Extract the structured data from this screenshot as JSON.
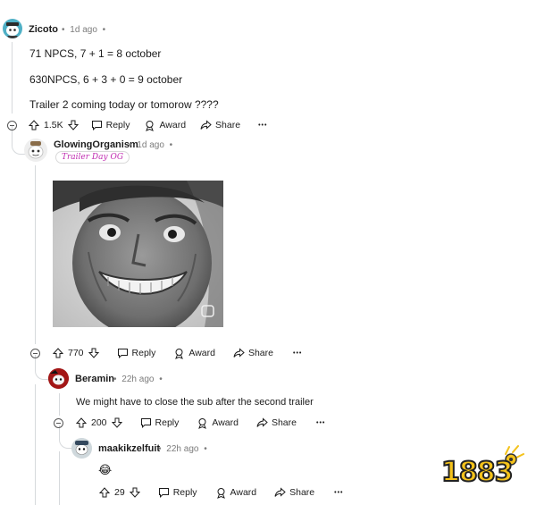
{
  "comments": [
    {
      "username": "Zicoto",
      "age": "1d ago",
      "lines": [
        "71 NPCS, 7 + 1 = 8 october",
        "630NPCS, 6 + 3 + 0 = 9 october",
        "Trailer 2 coming today or tomorow ????"
      ],
      "votes": "1.5K",
      "reply_label": "Reply",
      "award_label": "Award",
      "share_label": "Share",
      "more_label": "•••"
    },
    {
      "username": "GlowingOrganism",
      "age": "1d ago",
      "flair": "Trailer Day OG",
      "image_icon": "gif-reaction-image",
      "votes": "770",
      "reply_label": "Reply",
      "award_label": "Award",
      "share_label": "Share",
      "more_label": "•••"
    },
    {
      "username": "Beramin",
      "age": "22h ago",
      "text": "We might have to close the sub after the second trailer",
      "votes": "200",
      "reply_label": "Reply",
      "award_label": "Award",
      "share_label": "Share",
      "more_label": "•••"
    },
    {
      "username": "maakikzelfuit",
      "age": "22h ago",
      "emoji": "😂",
      "votes": "29",
      "reply_label": "Reply",
      "award_label": "Award",
      "share_label": "Share",
      "more_label": "•••"
    }
  ],
  "separator": "•",
  "watermark": "1883",
  "colors": {
    "text": "#1c1c1c",
    "muted": "#7c7c7c",
    "flair": "#c02bb0",
    "watermark": "#f4c21a"
  }
}
